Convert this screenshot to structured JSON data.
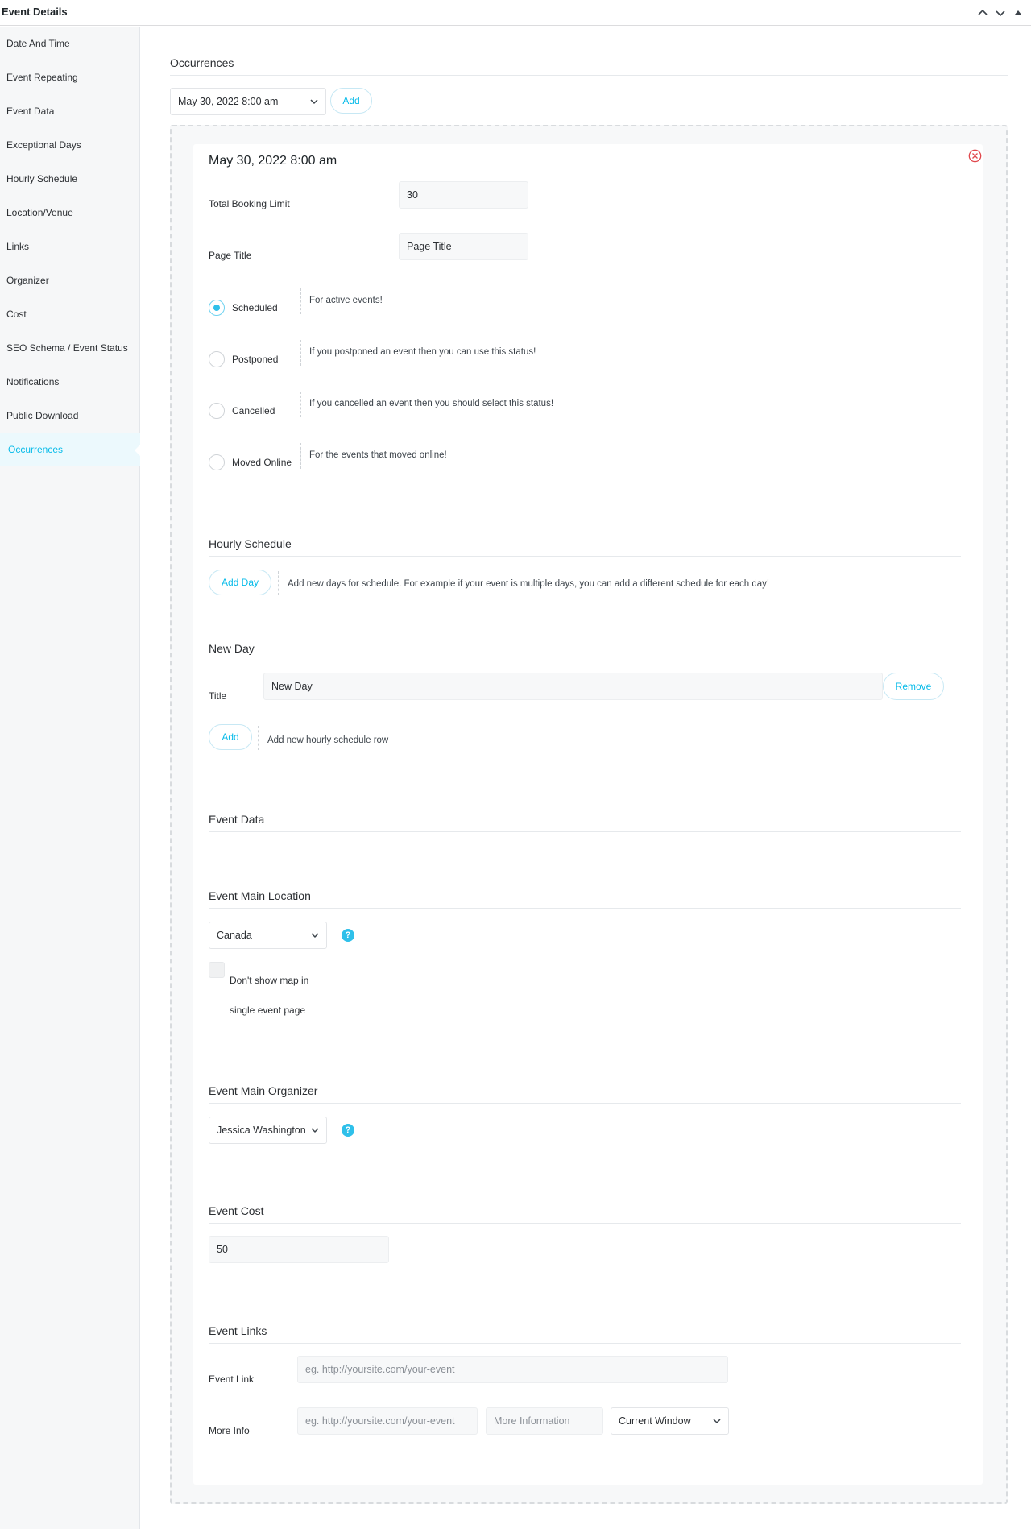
{
  "header": {
    "title": "Event Details"
  },
  "sidebar": {
    "items": [
      {
        "label": "Date And Time"
      },
      {
        "label": "Event Repeating"
      },
      {
        "label": "Event Data"
      },
      {
        "label": "Exceptional Days"
      },
      {
        "label": "Hourly Schedule"
      },
      {
        "label": "Location/Venue"
      },
      {
        "label": "Links"
      },
      {
        "label": "Organizer"
      },
      {
        "label": "Cost"
      },
      {
        "label": "SEO Schema / Event Status"
      },
      {
        "label": "Notifications"
      },
      {
        "label": "Public Download"
      },
      {
        "label": "Occurrences"
      }
    ],
    "active": "Occurrences"
  },
  "occurrences": {
    "title": "Occurrences",
    "selected_date": "May 30, 2022 8:00 am",
    "add_label": "Add"
  },
  "occurrence": {
    "title": "May 30, 2022 8:00 am",
    "booking_limit": {
      "label": "Total Booking Limit",
      "value": "30"
    },
    "page_title": {
      "label": "Page Title",
      "placeholder": "Page Title"
    },
    "statuses": [
      {
        "label": "Scheduled",
        "description": "For active events!",
        "checked": true
      },
      {
        "label": "Postponed",
        "description": "If you postponed an event then you can use this status!",
        "checked": false
      },
      {
        "label": "Cancelled",
        "description": "If you cancelled an event then you should select this status!",
        "checked": false
      },
      {
        "label": "Moved Online",
        "description": "For the events that moved online!",
        "checked": false
      }
    ]
  },
  "hourly_schedule": {
    "title": "Hourly Schedule",
    "add_day_label": "Add Day",
    "add_day_desc": "Add new days for schedule. For example if your event is multiple days, you can add a different schedule for each day!",
    "day_title": "New Day",
    "title_label": "Title",
    "title_value": "New Day",
    "remove_label": "Remove",
    "add_label": "Add",
    "add_row_desc": "Add new hourly schedule row"
  },
  "event_data": {
    "title": "Event Data"
  },
  "location": {
    "title": "Event Main Location",
    "selected": "Canada",
    "dont_show_map_line1": "Don't show map in",
    "dont_show_map_line2": "single event page"
  },
  "organizer": {
    "title": "Event Main Organizer",
    "selected": "Jessica Washington"
  },
  "cost": {
    "title": "Event Cost",
    "value": "50"
  },
  "links": {
    "title": "Event Links",
    "event_link_label": "Event Link",
    "event_link_placeholder": "eg. http://yoursite.com/your-event",
    "more_info_label": "More Info",
    "more_info_placeholder": "eg. http://yoursite.com/your-event",
    "more_info_text_placeholder": "More Information",
    "target_selected": "Current Window"
  },
  "icons": {
    "help": "?",
    "accent_color": "#07bbe9",
    "close_color": "#e0474c"
  }
}
